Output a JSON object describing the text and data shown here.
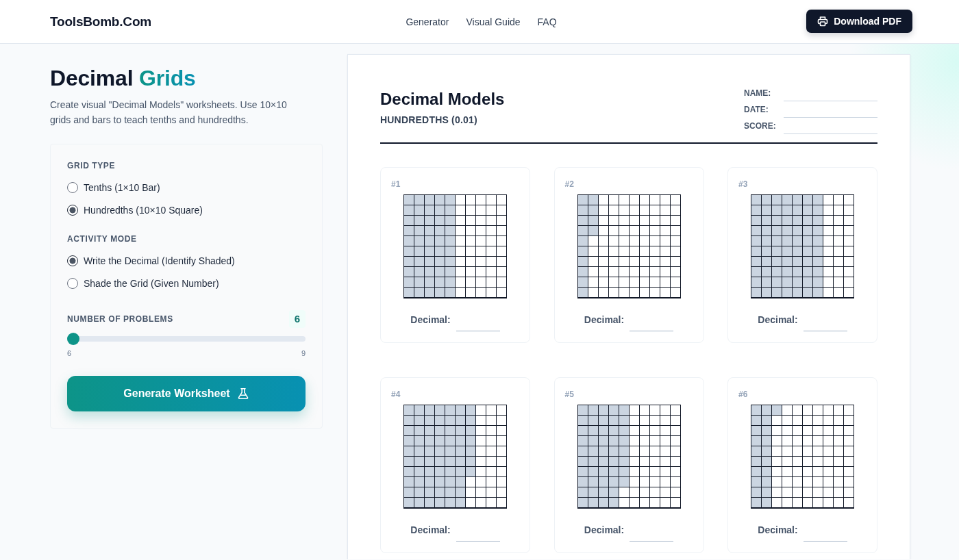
{
  "header": {
    "logo": "ToolsBomb.Com",
    "nav": [
      {
        "label": "Generator"
      },
      {
        "label": "Visual Guide"
      },
      {
        "label": "FAQ"
      }
    ],
    "download_button": "Download PDF"
  },
  "intro": {
    "title": "Decimal",
    "title_highlight": "Grids",
    "description": "Create visual \"Decimal Models\" worksheets. Use 10×10 grids and bars to teach tenths and hundredths."
  },
  "settings": {
    "groups": [
      {
        "label": "GRID TYPE",
        "options": [
          {
            "label": "Tenths (1×10 Bar)",
            "selected": false
          },
          {
            "label": "Hundredths (10×10 Square)",
            "selected": true
          }
        ]
      },
      {
        "label": "ACTIVITY MODE",
        "options": [
          {
            "label": "Write the Decimal (Identify Shaded)",
            "selected": true
          },
          {
            "label": "Shade the Grid (Given Number)",
            "selected": false
          }
        ]
      }
    ],
    "problem_count": {
      "label": "NUMBER OF PROBLEMS",
      "value": "6",
      "level": 0,
      "min": "6",
      "max": "9"
    },
    "generate_button": "Generate Worksheet"
  },
  "worksheet": {
    "title": "Decimal Models",
    "subtitle": "HUNDREDTHS (0.01)",
    "fields": [
      {
        "label": "NAME:"
      },
      {
        "label": "DATE:"
      },
      {
        "label": "SCORE:"
      }
    ],
    "problems": [
      {
        "number": "#1",
        "shaded_columns": [
          {
            "level": 1
          },
          {
            "level": 1
          },
          {
            "level": 1
          },
          {
            "level": 1
          },
          {
            "level": 1
          }
        ],
        "answer_label": "Decimal:"
      },
      {
        "number": "#2",
        "shaded_columns": [
          {
            "level": 1
          },
          {
            "level": 0.4
          }
        ],
        "answer_label": "Decimal:"
      },
      {
        "number": "#3",
        "shaded_columns": [
          {
            "level": 1
          },
          {
            "level": 1
          },
          {
            "level": 1
          },
          {
            "level": 1
          },
          {
            "level": 1
          },
          {
            "level": 1
          },
          {
            "level": 1
          }
        ],
        "answer_label": "Decimal:"
      },
      {
        "number": "#4",
        "shaded_columns": [
          {
            "level": 1
          },
          {
            "level": 1
          },
          {
            "level": 1
          },
          {
            "level": 1
          },
          {
            "level": 1
          },
          {
            "level": 1
          },
          {
            "level": 0.7
          }
        ],
        "answer_label": "Decimal:"
      },
      {
        "number": "#5",
        "shaded_columns": [
          {
            "level": 1
          },
          {
            "level": 1
          },
          {
            "level": 1
          },
          {
            "level": 1
          },
          {
            "level": 0.8
          }
        ],
        "answer_label": "Decimal:"
      },
      {
        "number": "#6",
        "shaded_columns": [
          {
            "level": 1
          },
          {
            "level": 1
          },
          {
            "level": 0.1
          }
        ],
        "answer_label": "Decimal:"
      }
    ]
  }
}
